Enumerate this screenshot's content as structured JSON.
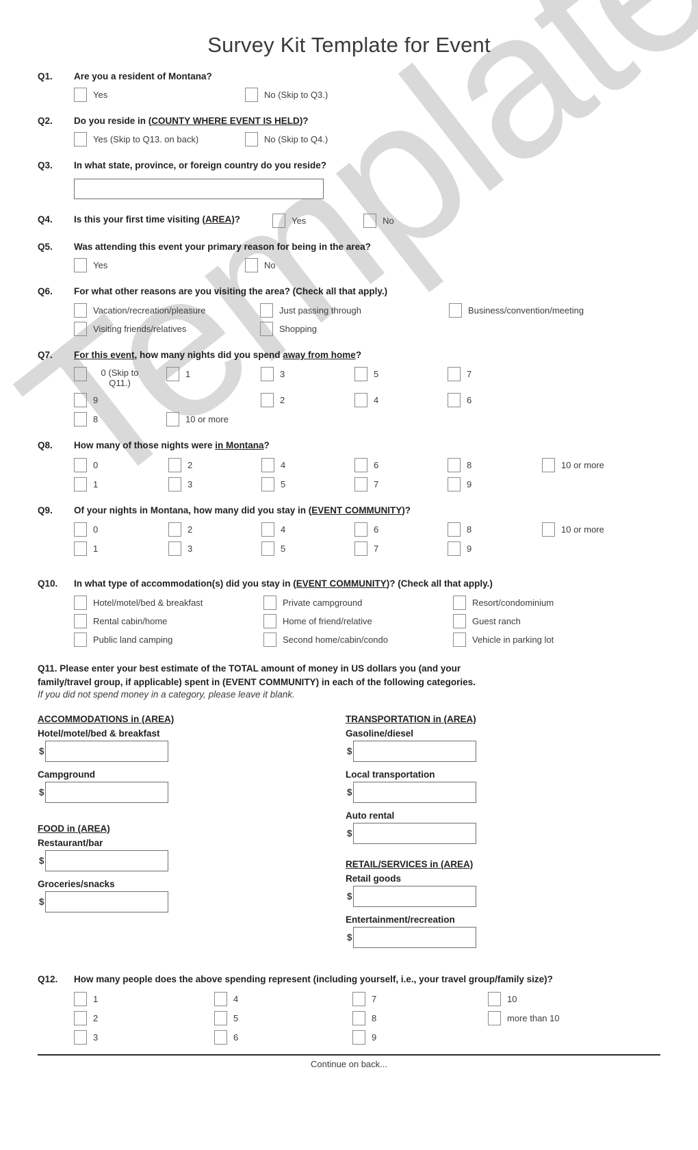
{
  "document": {
    "title": "Survey Kit Template for Event",
    "watermark": "Template",
    "footer": "Continue on back...",
    "accent_color": "#231f20",
    "watermark_color": "#d9d9d9"
  },
  "questions": {
    "q1": {
      "number": "Q1.",
      "text_parts": {
        "a": "Are you a resident of Montana?"
      },
      "options": [
        "Yes",
        "No (Skip to Q3.)"
      ]
    },
    "q2": {
      "number": "Q2.",
      "text_parts": {
        "a": "Do you reside in (",
        "u": "COUNTY WHERE EVENT IS HELD",
        "b": ")?"
      },
      "options": [
        "Yes (Skip to Q13. on back)",
        "No (Skip to Q4.)"
      ]
    },
    "q3": {
      "number": "Q3.",
      "text_parts": {
        "a": "In what state, province, or foreign country do you reside?"
      },
      "input_value": ""
    },
    "q4": {
      "number": "Q4.",
      "text_parts": {
        "a": "Is this your first time visiting (",
        "u": "AREA",
        "b": ")?"
      },
      "options": [
        "Yes",
        "No"
      ]
    },
    "q5": {
      "number": "Q5.",
      "text_parts": {
        "a": "Was attending this event your primary reason for being in the area?"
      },
      "options": [
        "Yes",
        "No"
      ]
    },
    "q6": {
      "number": "Q6.",
      "text_parts": {
        "a": "For what other reasons are you visiting the area? (Check all that apply.)"
      },
      "options": [
        "Vacation/recreation/pleasure",
        "Just passing through",
        "Business/convention/meeting",
        "Visiting friends/relatives",
        "Shopping"
      ]
    },
    "q7": {
      "number": "Q7.",
      "text_parts": {
        "u1": "For this event",
        "a": ", how many nights did you spend ",
        "u2": "away from home",
        "b": "?"
      },
      "options": [
        "0 (Skip to Q11.)",
        "1",
        "2",
        "3",
        "4",
        "5",
        "6",
        "7",
        "8",
        "9",
        "10 or more"
      ]
    },
    "q8": {
      "number": "Q8.",
      "text_parts": {
        "a": "How many of those nights were ",
        "u": "in Montana",
        "b": "?"
      },
      "options": [
        "0",
        "1",
        "2",
        "3",
        "4",
        "5",
        "6",
        "7",
        "8",
        "9",
        "10 or more"
      ]
    },
    "q9": {
      "number": "Q9.",
      "text_parts": {
        "a": "Of your nights in Montana, how many did you stay in (",
        "u": "EVENT COMMUNITY",
        "b": ")?"
      },
      "options": [
        "0",
        "1",
        "2",
        "3",
        "4",
        "5",
        "6",
        "7",
        "8",
        "9",
        "10 or more"
      ]
    },
    "q10": {
      "number": "Q10.",
      "text_parts": {
        "a": "In what type of accommodation(s) did you stay in (",
        "u": "EVENT COMMUNITY",
        "b": ")? (Check all that apply.)"
      },
      "options": [
        "Hotel/motel/bed & breakfast",
        "Private campground",
        "Resort/condominium",
        "Rental cabin/home",
        "Home of friend/relative",
        "Guest ranch",
        "Public land camping",
        "Second home/cabin/condo",
        "Vehicle in parking lot"
      ]
    },
    "q11": {
      "number": "Q11.",
      "line1": "Q11. Please enter your best estimate of the TOTAL amount of money in US dollars you (and your",
      "line2_a": "family/travel group, if applicable) spent in (",
      "line2_u": "EVENT COMMUNITY",
      "line2_b": ") in each of the following categories.",
      "note": "If you did not spend money in a category, please leave it blank.",
      "currency_symbol": "$",
      "groups": [
        {
          "heading": "ACCOMMODATIONS in (AREA)",
          "column": "left",
          "fields": [
            {
              "label": "Hotel/motel/bed & breakfast",
              "value": ""
            },
            {
              "label": "Campground",
              "value": ""
            }
          ]
        },
        {
          "heading": "FOOD in (AREA)",
          "column": "left",
          "fields": [
            {
              "label": "Restaurant/bar",
              "value": ""
            },
            {
              "label": "Groceries/snacks",
              "value": ""
            }
          ]
        },
        {
          "heading": "TRANSPORTATION in (AREA)",
          "column": "right",
          "fields": [
            {
              "label": "Gasoline/diesel",
              "value": ""
            },
            {
              "label": "Local transportation",
              "value": ""
            },
            {
              "label": "Auto rental",
              "value": ""
            }
          ]
        },
        {
          "heading": "RETAIL/SERVICES in (AREA)",
          "column": "right",
          "fields": [
            {
              "label": "Retail goods",
              "value": ""
            },
            {
              "label": "Entertainment/recreation",
              "value": ""
            }
          ]
        }
      ]
    },
    "q12": {
      "number": "Q12.",
      "text_parts": {
        "a": "How many people does the above spending represent (including yourself, i.e., your travel group/family size)?"
      },
      "options": [
        "1",
        "2",
        "3",
        "4",
        "5",
        "6",
        "7",
        "8",
        "9",
        "10",
        "more than 10"
      ]
    }
  }
}
